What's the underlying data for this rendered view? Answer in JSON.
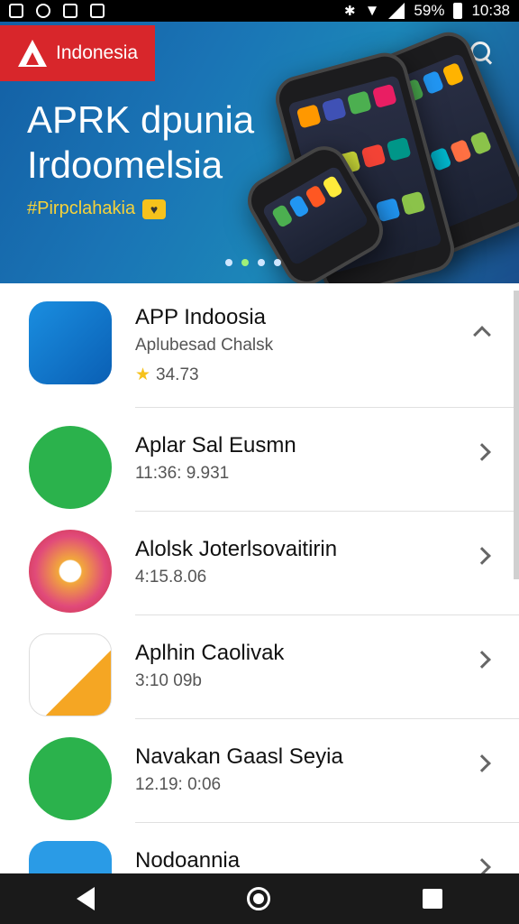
{
  "status_bar": {
    "battery": "59%",
    "time": "10:38"
  },
  "hero": {
    "brand": "Indonesia",
    "title_line1": "APRK dpunia",
    "title_line2": "Irdoomelsia",
    "tagline": "#Pirpclahakia"
  },
  "apps": [
    {
      "name": "APP Indoosia",
      "subtitle": "Aplubesad Chalsk",
      "rating": "34.73"
    },
    {
      "name": "Aplar Sal Eusmn",
      "subtitle": "11:36: 9.931"
    },
    {
      "name": "Alolsk Joterlsovaitirin",
      "subtitle": "4:15.8.06"
    },
    {
      "name": "Aplhin Caolivak",
      "subtitle": "3:10 09b"
    },
    {
      "name": "Navakan Gaasl Seyia",
      "subtitle": "12.19: 0:06"
    },
    {
      "name": "Nodoannia",
      "subtitle": ""
    }
  ],
  "colors": {
    "brand_red": "#d8262b",
    "star": "#f6c21c",
    "hero_blue": "#1a74b5"
  }
}
